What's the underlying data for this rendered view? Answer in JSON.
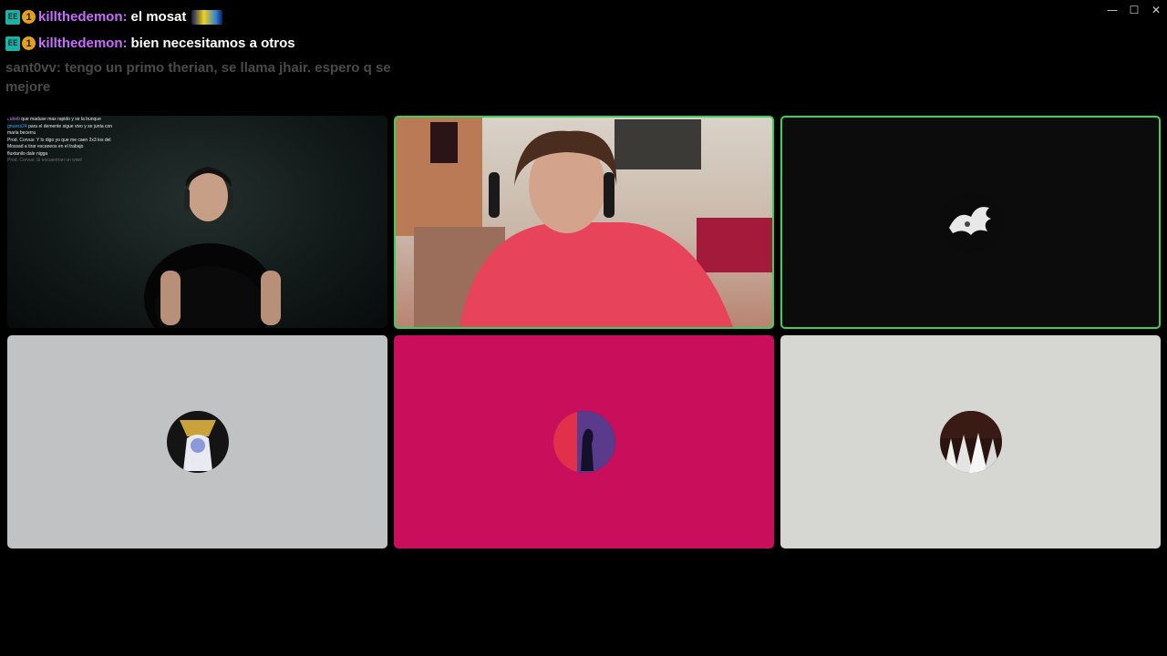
{
  "window": {
    "controls": {
      "minimize": "—",
      "maximize": "☐",
      "close": "✕"
    }
  },
  "chat": {
    "messages": [
      {
        "user": "killthedemon:",
        "text": "el mosat",
        "user_color": "#c86bff",
        "badge_number": "1",
        "has_emote": true
      },
      {
        "user": "killthedemon:",
        "text": "bien necesitamos a otros",
        "user_color": "#c86bff",
        "badge_number": "1",
        "has_emote": false
      }
    ],
    "faded_message": "sant0vv: tengo un primo therian, se llama jhair. espero q se mejore"
  },
  "tiles": [
    {
      "overlay_chat": [
        {
          "user": "Lubeb",
          "text": " que maduse mas rapido y se la bunque"
        },
        {
          "user": "gnuess24",
          "text": " para el demente sigue vivo y se junta con maria becerra"
        },
        {
          "user": "Prod. Corvus:",
          "text": " Y lo digo yo que me caen 2x3 los del Mossad a tirar escaneos en el trabajo"
        },
        {
          "user": "fluxtanilo",
          "text": " dale nigga"
        },
        {
          "user": "Prod. Corvus:",
          "text": " Si encuentran un wiwii",
          "dim": true
        }
      ]
    },
    {
      "speaking": true
    },
    {
      "speaking": true
    },
    {
      "bg": "#c0c2c4"
    },
    {
      "bg": "#c90e5c"
    },
    {
      "bg": "#d6d7d2"
    }
  ],
  "colors": {
    "speaking_border": "#3fcf58",
    "username": "#c86bff",
    "faded_text": "#4a4a4a"
  }
}
